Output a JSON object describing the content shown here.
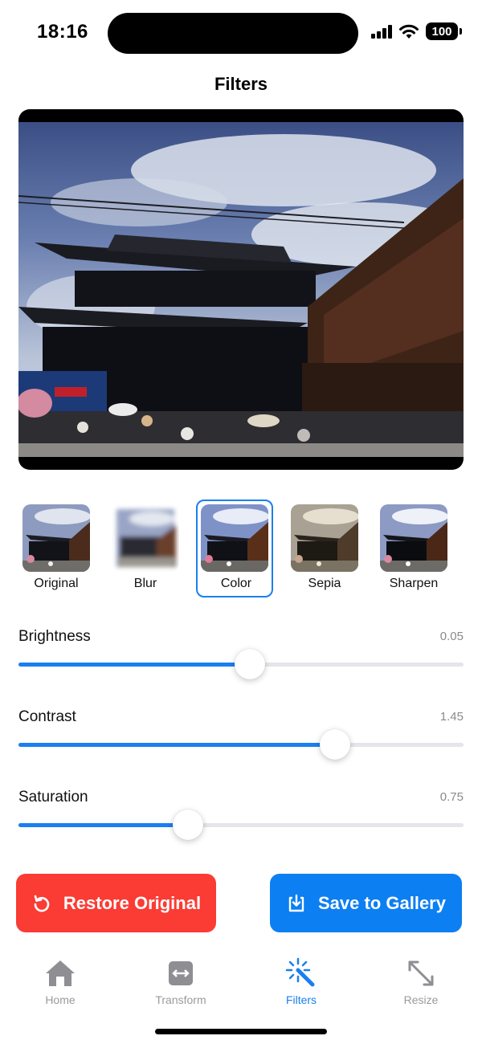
{
  "status_bar": {
    "time": "18:16",
    "battery": "100"
  },
  "nav": {
    "title": "Filters"
  },
  "photo": {
    "alt": "temple-gate-photo"
  },
  "filters": {
    "selected_index": 2,
    "items": [
      {
        "label": "Original"
      },
      {
        "label": "Blur"
      },
      {
        "label": "Color"
      },
      {
        "label": "Sepia"
      },
      {
        "label": "Sharpen"
      }
    ]
  },
  "sliders": [
    {
      "label": "Brightness",
      "value": "0.05",
      "fill_fraction": 0.52
    },
    {
      "label": "Contrast",
      "value": "1.45",
      "fill_fraction": 0.711
    },
    {
      "label": "Saturation",
      "value": "0.75",
      "fill_fraction": 0.381
    }
  ],
  "buttons": {
    "restore_label": "Restore Original",
    "save_label": "Save to Gallery"
  },
  "tabs": [
    {
      "label": "Home",
      "icon": "house-icon",
      "active": false
    },
    {
      "label": "Transform",
      "icon": "resize-arrows-icon",
      "active": false
    },
    {
      "label": "Filters",
      "icon": "magic-wand-icon",
      "active": true
    },
    {
      "label": "Resize",
      "icon": "expand-arrows-icon",
      "active": false
    }
  ],
  "colors": {
    "accent": "#1a7ff0",
    "restore": "#fa3c34",
    "save": "#0c7ff2",
    "tab_inactive": "#9a9a9e"
  }
}
